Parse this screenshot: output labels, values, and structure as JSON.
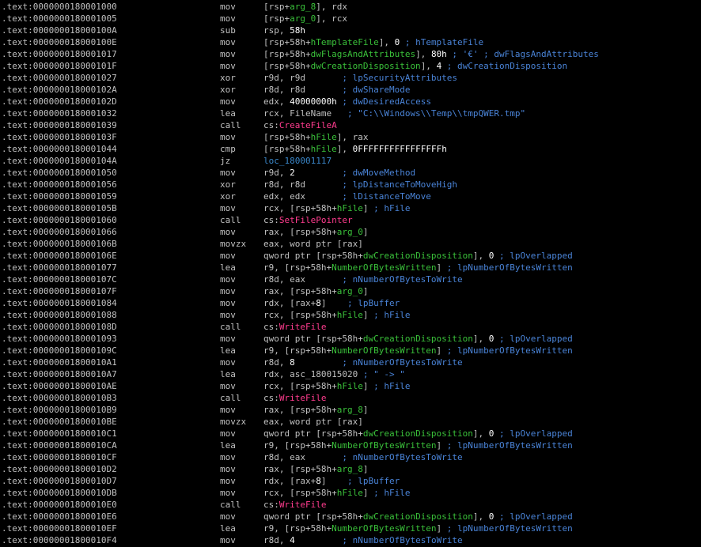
{
  "colors": {
    "background": "#000000",
    "text": "#c0c0c0",
    "stack_var": "#3ac13a",
    "immediate": "#ffffff",
    "comment": "#4a84d8",
    "api_name": "#ff3c8e",
    "label": "#3a86c8"
  },
  "lines": [
    {
      "addr": ".text:0000000180001000",
      "mnem": "mov",
      "ops": [
        {
          "t": "[rsp+",
          "c": "plain"
        },
        {
          "t": "arg_8",
          "c": "var"
        },
        {
          "t": "], rdx",
          "c": "plain"
        }
      ]
    },
    {
      "addr": ".text:0000000180001005",
      "mnem": "mov",
      "ops": [
        {
          "t": "[rsp+",
          "c": "plain"
        },
        {
          "t": "arg_0",
          "c": "var"
        },
        {
          "t": "], rcx",
          "c": "plain"
        }
      ]
    },
    {
      "addr": ".text:000000018000100A",
      "mnem": "sub",
      "ops": [
        {
          "t": "rsp, ",
          "c": "plain"
        },
        {
          "t": "58h",
          "c": "num"
        }
      ]
    },
    {
      "addr": ".text:000000018000100E",
      "mnem": "mov",
      "ops": [
        {
          "t": "[rsp+58h+",
          "c": "plain"
        },
        {
          "t": "hTemplateFile",
          "c": "var"
        },
        {
          "t": "], ",
          "c": "plain"
        },
        {
          "t": "0",
          "c": "num"
        },
        {
          "t": " ; hTemplateFile",
          "c": "comment"
        }
      ]
    },
    {
      "addr": ".text:0000000180001017",
      "mnem": "mov",
      "ops": [
        {
          "t": "[rsp+58h+",
          "c": "plain"
        },
        {
          "t": "dwFlagsAndAttributes",
          "c": "var"
        },
        {
          "t": "], ",
          "c": "plain"
        },
        {
          "t": "80h",
          "c": "num"
        },
        {
          "t": " ; '€' ; dwFlagsAndAttributes",
          "c": "comment"
        }
      ]
    },
    {
      "addr": ".text:000000018000101F",
      "mnem": "mov",
      "ops": [
        {
          "t": "[rsp+58h+",
          "c": "plain"
        },
        {
          "t": "dwCreationDisposition",
          "c": "var"
        },
        {
          "t": "], ",
          "c": "plain"
        },
        {
          "t": "4",
          "c": "num"
        },
        {
          "t": " ; dwCreationDisposition",
          "c": "comment"
        }
      ]
    },
    {
      "addr": ".text:0000000180001027",
      "mnem": "xor",
      "ops": [
        {
          "t": "r9d, r9d       ",
          "c": "plain"
        },
        {
          "t": "; lpSecurityAttributes",
          "c": "comment"
        }
      ]
    },
    {
      "addr": ".text:000000018000102A",
      "mnem": "xor",
      "ops": [
        {
          "t": "r8d, r8d       ",
          "c": "plain"
        },
        {
          "t": "; dwShareMode",
          "c": "comment"
        }
      ]
    },
    {
      "addr": ".text:000000018000102D",
      "mnem": "mov",
      "ops": [
        {
          "t": "edx, ",
          "c": "plain"
        },
        {
          "t": "40000000h",
          "c": "num"
        },
        {
          "t": " ",
          "c": "plain"
        },
        {
          "t": "; dwDesiredAccess",
          "c": "comment"
        }
      ]
    },
    {
      "addr": ".text:0000000180001032",
      "mnem": "lea",
      "ops": [
        {
          "t": "rcx, FileName   ",
          "c": "plain"
        },
        {
          "t": "; \"C:\\\\Windows\\\\Temp\\\\tmpQWER.tmp\"",
          "c": "comment"
        }
      ]
    },
    {
      "addr": ".text:0000000180001039",
      "mnem": "call",
      "ops": [
        {
          "t": "cs:",
          "c": "plain"
        },
        {
          "t": "CreateFileA",
          "c": "api"
        }
      ]
    },
    {
      "addr": ".text:000000018000103F",
      "mnem": "mov",
      "ops": [
        {
          "t": "[rsp+58h+",
          "c": "plain"
        },
        {
          "t": "hFile",
          "c": "var"
        },
        {
          "t": "], rax",
          "c": "plain"
        }
      ]
    },
    {
      "addr": ".text:0000000180001044",
      "mnem": "cmp",
      "ops": [
        {
          "t": "[rsp+58h+",
          "c": "plain"
        },
        {
          "t": "hFile",
          "c": "var"
        },
        {
          "t": "], ",
          "c": "plain"
        },
        {
          "t": "0FFFFFFFFFFFFFFFFh",
          "c": "num"
        }
      ]
    },
    {
      "addr": ".text:000000018000104A",
      "mnem": "jz",
      "ops": [
        {
          "t": "loc_180001117",
          "c": "loc"
        }
      ]
    },
    {
      "addr": ".text:0000000180001050",
      "mnem": "mov",
      "ops": [
        {
          "t": "r9d, ",
          "c": "plain"
        },
        {
          "t": "2",
          "c": "num"
        },
        {
          "t": "         ",
          "c": "plain"
        },
        {
          "t": "; dwMoveMethod",
          "c": "comment"
        }
      ]
    },
    {
      "addr": ".text:0000000180001056",
      "mnem": "xor",
      "ops": [
        {
          "t": "r8d, r8d       ",
          "c": "plain"
        },
        {
          "t": "; lpDistanceToMoveHigh",
          "c": "comment"
        }
      ]
    },
    {
      "addr": ".text:0000000180001059",
      "mnem": "xor",
      "ops": [
        {
          "t": "edx, edx       ",
          "c": "plain"
        },
        {
          "t": "; lDistanceToMove",
          "c": "comment"
        }
      ]
    },
    {
      "addr": ".text:000000018000105B",
      "mnem": "mov",
      "ops": [
        {
          "t": "rcx, [rsp+58h+",
          "c": "plain"
        },
        {
          "t": "hFile",
          "c": "var"
        },
        {
          "t": "] ",
          "c": "plain"
        },
        {
          "t": "; hFile",
          "c": "comment"
        }
      ]
    },
    {
      "addr": ".text:0000000180001060",
      "mnem": "call",
      "ops": [
        {
          "t": "cs:",
          "c": "plain"
        },
        {
          "t": "SetFilePointer",
          "c": "api"
        }
      ]
    },
    {
      "addr": ".text:0000000180001066",
      "mnem": "mov",
      "ops": [
        {
          "t": "rax, [rsp+58h+",
          "c": "plain"
        },
        {
          "t": "arg_0",
          "c": "var"
        },
        {
          "t": "]",
          "c": "plain"
        }
      ]
    },
    {
      "addr": ".text:000000018000106B",
      "mnem": "movzx",
      "ops": [
        {
          "t": "eax, word ptr [rax]",
          "c": "plain"
        }
      ]
    },
    {
      "addr": ".text:000000018000106E",
      "mnem": "mov",
      "ops": [
        {
          "t": "qword ptr [rsp+58h+",
          "c": "plain"
        },
        {
          "t": "dwCreationDisposition",
          "c": "var"
        },
        {
          "t": "], ",
          "c": "plain"
        },
        {
          "t": "0",
          "c": "num"
        },
        {
          "t": " ; lpOverlapped",
          "c": "comment"
        }
      ]
    },
    {
      "addr": ".text:0000000180001077",
      "mnem": "lea",
      "ops": [
        {
          "t": "r9, [rsp+58h+",
          "c": "plain"
        },
        {
          "t": "NumberOfBytesWritten",
          "c": "var"
        },
        {
          "t": "] ",
          "c": "plain"
        },
        {
          "t": "; lpNumberOfBytesWritten",
          "c": "comment"
        }
      ]
    },
    {
      "addr": ".text:000000018000107C",
      "mnem": "mov",
      "ops": [
        {
          "t": "r8d, eax       ",
          "c": "plain"
        },
        {
          "t": "; nNumberOfBytesToWrite",
          "c": "comment"
        }
      ]
    },
    {
      "addr": ".text:000000018000107F",
      "mnem": "mov",
      "ops": [
        {
          "t": "rax, [rsp+58h+",
          "c": "plain"
        },
        {
          "t": "arg_0",
          "c": "var"
        },
        {
          "t": "]",
          "c": "plain"
        }
      ]
    },
    {
      "addr": ".text:0000000180001084",
      "mnem": "mov",
      "ops": [
        {
          "t": "rdx, [rax+",
          "c": "plain"
        },
        {
          "t": "8",
          "c": "num"
        },
        {
          "t": "]    ",
          "c": "plain"
        },
        {
          "t": "; lpBuffer",
          "c": "comment"
        }
      ]
    },
    {
      "addr": ".text:0000000180001088",
      "mnem": "mov",
      "ops": [
        {
          "t": "rcx, [rsp+58h+",
          "c": "plain"
        },
        {
          "t": "hFile",
          "c": "var"
        },
        {
          "t": "] ",
          "c": "plain"
        },
        {
          "t": "; hFile",
          "c": "comment"
        }
      ]
    },
    {
      "addr": ".text:000000018000108D",
      "mnem": "call",
      "ops": [
        {
          "t": "cs:",
          "c": "plain"
        },
        {
          "t": "WriteFile",
          "c": "api"
        }
      ]
    },
    {
      "addr": ".text:0000000180001093",
      "mnem": "mov",
      "ops": [
        {
          "t": "qword ptr [rsp+58h+",
          "c": "plain"
        },
        {
          "t": "dwCreationDisposition",
          "c": "var"
        },
        {
          "t": "], ",
          "c": "plain"
        },
        {
          "t": "0",
          "c": "num"
        },
        {
          "t": " ; lpOverlapped",
          "c": "comment"
        }
      ]
    },
    {
      "addr": ".text:000000018000109C",
      "mnem": "lea",
      "ops": [
        {
          "t": "r9, [rsp+58h+",
          "c": "plain"
        },
        {
          "t": "NumberOfBytesWritten",
          "c": "var"
        },
        {
          "t": "] ",
          "c": "plain"
        },
        {
          "t": "; lpNumberOfBytesWritten",
          "c": "comment"
        }
      ]
    },
    {
      "addr": ".text:00000001800010A1",
      "mnem": "mov",
      "ops": [
        {
          "t": "r8d, ",
          "c": "plain"
        },
        {
          "t": "8",
          "c": "num"
        },
        {
          "t": "         ",
          "c": "plain"
        },
        {
          "t": "; nNumberOfBytesToWrite",
          "c": "comment"
        }
      ]
    },
    {
      "addr": ".text:00000001800010A7",
      "mnem": "lea",
      "ops": [
        {
          "t": "rdx, asc_180015020 ",
          "c": "plain"
        },
        {
          "t": "; \" -> \"",
          "c": "comment"
        }
      ]
    },
    {
      "addr": ".text:00000001800010AE",
      "mnem": "mov",
      "ops": [
        {
          "t": "rcx, [rsp+58h+",
          "c": "plain"
        },
        {
          "t": "hFile",
          "c": "var"
        },
        {
          "t": "] ",
          "c": "plain"
        },
        {
          "t": "; hFile",
          "c": "comment"
        }
      ]
    },
    {
      "addr": ".text:00000001800010B3",
      "mnem": "call",
      "ops": [
        {
          "t": "cs:",
          "c": "plain"
        },
        {
          "t": "WriteFile",
          "c": "api"
        }
      ]
    },
    {
      "addr": ".text:00000001800010B9",
      "mnem": "mov",
      "ops": [
        {
          "t": "rax, [rsp+58h+",
          "c": "plain"
        },
        {
          "t": "arg_8",
          "c": "var"
        },
        {
          "t": "]",
          "c": "plain"
        }
      ]
    },
    {
      "addr": ".text:00000001800010BE",
      "mnem": "movzx",
      "ops": [
        {
          "t": "eax, word ptr [rax]",
          "c": "plain"
        }
      ]
    },
    {
      "addr": ".text:00000001800010C1",
      "mnem": "mov",
      "ops": [
        {
          "t": "qword ptr [rsp+58h+",
          "c": "plain"
        },
        {
          "t": "dwCreationDisposition",
          "c": "var"
        },
        {
          "t": "], ",
          "c": "plain"
        },
        {
          "t": "0",
          "c": "num"
        },
        {
          "t": " ; lpOverlapped",
          "c": "comment"
        }
      ]
    },
    {
      "addr": ".text:00000001800010CA",
      "mnem": "lea",
      "ops": [
        {
          "t": "r9, [rsp+58h+",
          "c": "plain"
        },
        {
          "t": "NumberOfBytesWritten",
          "c": "var"
        },
        {
          "t": "] ",
          "c": "plain"
        },
        {
          "t": "; lpNumberOfBytesWritten",
          "c": "comment"
        }
      ]
    },
    {
      "addr": ".text:00000001800010CF",
      "mnem": "mov",
      "ops": [
        {
          "t": "r8d, eax       ",
          "c": "plain"
        },
        {
          "t": "; nNumberOfBytesToWrite",
          "c": "comment"
        }
      ]
    },
    {
      "addr": ".text:00000001800010D2",
      "mnem": "mov",
      "ops": [
        {
          "t": "rax, [rsp+58h+",
          "c": "plain"
        },
        {
          "t": "arg_8",
          "c": "var"
        },
        {
          "t": "]",
          "c": "plain"
        }
      ]
    },
    {
      "addr": ".text:00000001800010D7",
      "mnem": "mov",
      "ops": [
        {
          "t": "rdx, [rax+",
          "c": "plain"
        },
        {
          "t": "8",
          "c": "num"
        },
        {
          "t": "]    ",
          "c": "plain"
        },
        {
          "t": "; lpBuffer",
          "c": "comment"
        }
      ]
    },
    {
      "addr": ".text:00000001800010DB",
      "mnem": "mov",
      "ops": [
        {
          "t": "rcx, [rsp+58h+",
          "c": "plain"
        },
        {
          "t": "hFile",
          "c": "var"
        },
        {
          "t": "] ",
          "c": "plain"
        },
        {
          "t": "; hFile",
          "c": "comment"
        }
      ]
    },
    {
      "addr": ".text:00000001800010E0",
      "mnem": "call",
      "ops": [
        {
          "t": "cs:",
          "c": "plain"
        },
        {
          "t": "WriteFile",
          "c": "api"
        }
      ]
    },
    {
      "addr": ".text:00000001800010E6",
      "mnem": "mov",
      "ops": [
        {
          "t": "qword ptr [rsp+58h+",
          "c": "plain"
        },
        {
          "t": "dwCreationDisposition",
          "c": "var"
        },
        {
          "t": "], ",
          "c": "plain"
        },
        {
          "t": "0",
          "c": "num"
        },
        {
          "t": " ; lpOverlapped",
          "c": "comment"
        }
      ]
    },
    {
      "addr": ".text:00000001800010EF",
      "mnem": "lea",
      "ops": [
        {
          "t": "r9, [rsp+58h+",
          "c": "plain"
        },
        {
          "t": "NumberOfBytesWritten",
          "c": "var"
        },
        {
          "t": "] ",
          "c": "plain"
        },
        {
          "t": "; lpNumberOfBytesWritten",
          "c": "comment"
        }
      ]
    },
    {
      "addr": ".text:00000001800010F4",
      "mnem": "mov",
      "ops": [
        {
          "t": "r8d, ",
          "c": "plain"
        },
        {
          "t": "4",
          "c": "num"
        },
        {
          "t": "         ",
          "c": "plain"
        },
        {
          "t": "; nNumberOfBytesToWrite",
          "c": "comment"
        }
      ]
    }
  ]
}
